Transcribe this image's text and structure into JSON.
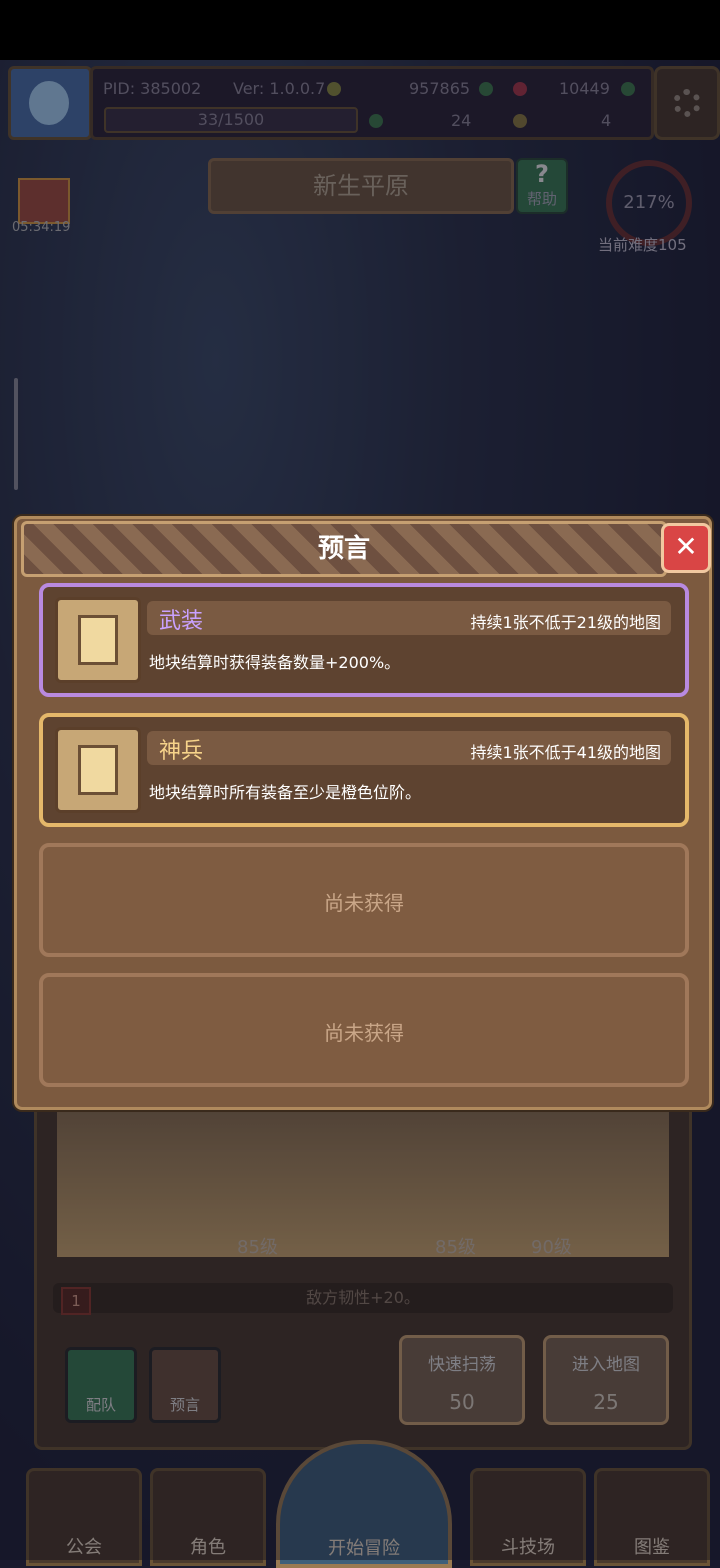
{
  "hud": {
    "pid": "PID: 385002",
    "version": "Ver: 1.0.0.7",
    "gold": "957865",
    "gems": "10449",
    "xp": "33/1500",
    "clover": "24",
    "keys": "4"
  },
  "region": {
    "name": "新生平原",
    "help": "帮助"
  },
  "gift_timer": "05:34:19",
  "difficulty": {
    "percent": "217%",
    "label": "当前难度105"
  },
  "modal": {
    "title": "预言",
    "close": "✕",
    "cards": [
      {
        "name": "武装",
        "condition": "持续1张不低于21级的地图",
        "desc": "地块结算时获得装备数量+200%。"
      },
      {
        "name": "神兵",
        "condition": "持续1张不低于41级的地图",
        "desc": "地块结算时所有装备至少是橙色位阶。"
      }
    ],
    "empty_slots": [
      "尚未获得",
      "尚未获得"
    ]
  },
  "party": {
    "level1": "85级",
    "level2": "85级",
    "level3": "90级",
    "stage_badge": "1",
    "effect": "敌方韧性+20。"
  },
  "actions": {
    "team": "配队",
    "prophecy": "预言",
    "sweep_label": "快速扫荡",
    "sweep_cost": "50",
    "enter_label": "进入地图",
    "enter_cost": "25"
  },
  "nav": {
    "guild": "公会",
    "character": "角色",
    "start": "开始冒险",
    "arena": "斗技场",
    "codex": "图鉴"
  }
}
